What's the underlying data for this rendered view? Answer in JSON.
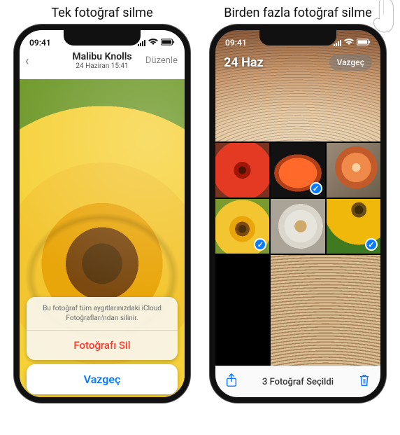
{
  "captions": {
    "single": "Tek fotoğraf silme",
    "multi": "Birden fazla fotoğraf silme"
  },
  "status": {
    "time": "09:41"
  },
  "phone1": {
    "title": "Malibu Knolls",
    "subtitle": "24 Haziran  15:41",
    "edit": "Düzenle",
    "sheet_message": "Bu fotoğraf tüm aygıtlarınızdaki iCloud Fotoğrafları'ndan silinir.",
    "delete_label": "Fotoğrafı Sil",
    "cancel_label": "Vazgeç"
  },
  "phone2": {
    "date": "24 Haz",
    "cancel": "Vazgeç",
    "toolbar_text": "3 Fotoğraf Seçildi",
    "thumbs": [
      {
        "name": "zinnia",
        "selected": false
      },
      {
        "name": "papaya",
        "selected": true
      },
      {
        "name": "grapefruit",
        "selected": false
      },
      {
        "name": "yellow-flower",
        "selected": true
      },
      {
        "name": "plate",
        "selected": false
      },
      {
        "name": "sunflower",
        "selected": true
      },
      {
        "name": "mushroom-large",
        "selected": false
      }
    ]
  },
  "colors": {
    "ios_blue": "#0a7aff",
    "ios_red": "#ff3b30"
  }
}
